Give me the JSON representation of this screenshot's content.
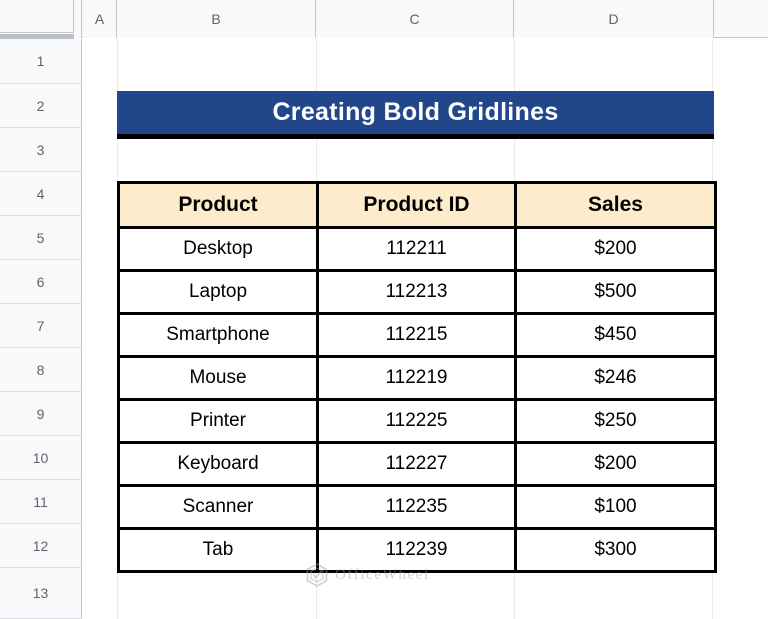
{
  "spreadsheet": {
    "column_headers": [
      "A",
      "B",
      "C",
      "D"
    ],
    "row_headers": [
      "1",
      "2",
      "3",
      "4",
      "5",
      "6",
      "7",
      "8",
      "9",
      "10",
      "11",
      "12",
      "13"
    ]
  },
  "banner": {
    "title": "Creating Bold Gridlines",
    "background_color": "#21468A",
    "text_color": "#FFFFFF",
    "border_color": "#000000"
  },
  "table": {
    "header_background": "#FCECCB",
    "border_color": "#000000",
    "columns": [
      "Product",
      "Product ID",
      "Sales"
    ],
    "rows": [
      {
        "product": "Desktop",
        "product_id": "112211",
        "sales": "$200"
      },
      {
        "product": "Laptop",
        "product_id": "112213",
        "sales": "$500"
      },
      {
        "product": "Smartphone",
        "product_id": "112215",
        "sales": "$450"
      },
      {
        "product": "Mouse",
        "product_id": "112219",
        "sales": "$246"
      },
      {
        "product": "Printer",
        "product_id": "112225",
        "sales": "$250"
      },
      {
        "product": "Keyboard",
        "product_id": "112227",
        "sales": "$200"
      },
      {
        "product": "Scanner",
        "product_id": "112235",
        "sales": "$100"
      },
      {
        "product": "Tab",
        "product_id": "112239",
        "sales": "$300"
      }
    ]
  },
  "watermark": {
    "text": "OfficeWheel",
    "icon": "hexagon-logo-icon"
  }
}
